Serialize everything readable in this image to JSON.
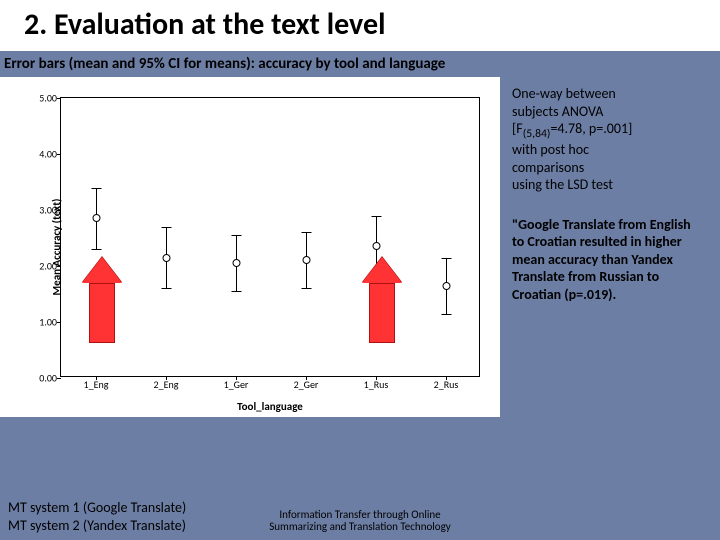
{
  "title": "2. Evaluation at the text level",
  "subtitle": "Error bars (mean and 95% CI for means): accuracy by tool and language",
  "side": {
    "para1_line1": "One-way between",
    "para1_line2": "subjects ANOVA",
    "para1_line3_pre": "[F",
    "para1_line3_sub": "(5,84)",
    "para1_line3_post": "=4.78, p=.001]",
    "para1_line4": "with post hoc",
    "para1_line5": "comparisons",
    "para1_line6": "using the LSD test",
    "para2": "\"Google Translate from English to Croatian resulted in higher mean accuracy than Yandex Translate from Russian to Croatian (p=.019)."
  },
  "legend": {
    "line1": "MT system 1 (Google Translate)",
    "line2": "MT system 2 (Yandex Translate)"
  },
  "footer": "Information Transfer through Online Summarizing and Translation Technology",
  "chart_data": {
    "type": "errorbar",
    "title": "",
    "xlabel": "Tool_language",
    "ylabel": "Mean Accuracy (text)",
    "ylim": [
      0,
      5
    ],
    "yticks": [
      0.0,
      1.0,
      2.0,
      3.0,
      4.0,
      5.0
    ],
    "categories": [
      "1_Eng",
      "2_Eng",
      "1_Ger",
      "2_Ger",
      "1_Rus",
      "2_Rus"
    ],
    "series": [
      {
        "name": "mean",
        "means": [
          2.85,
          2.15,
          2.05,
          2.1,
          2.35,
          1.65
        ],
        "ci_low": [
          2.3,
          1.6,
          1.55,
          1.6,
          1.8,
          1.15
        ],
        "ci_high": [
          3.4,
          2.7,
          2.55,
          2.6,
          2.9,
          2.15
        ]
      }
    ]
  }
}
